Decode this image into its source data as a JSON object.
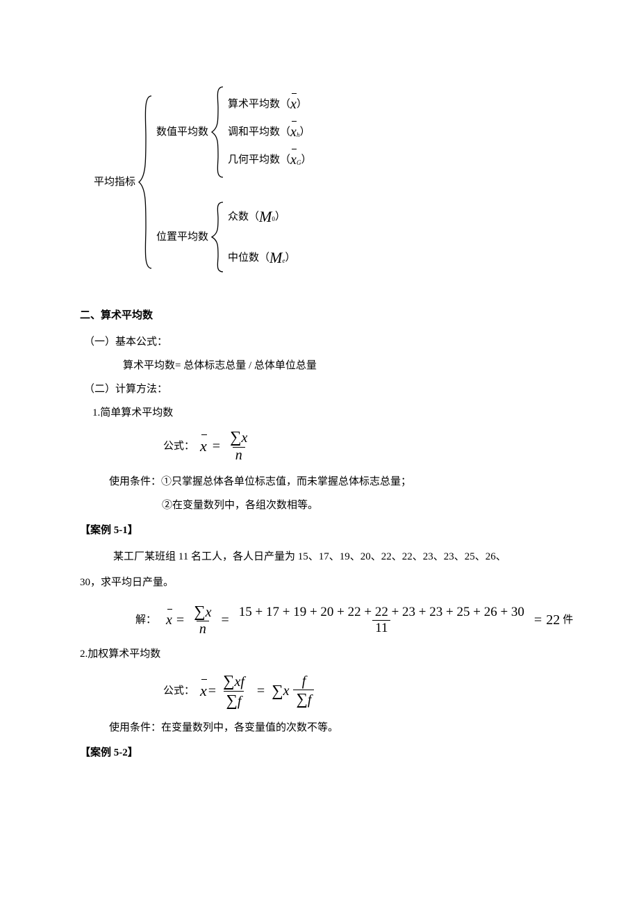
{
  "tree": {
    "root": "平均指标",
    "branch1": {
      "label": "数值平均数",
      "items": [
        {
          "text": "算术平均数（",
          "sym": "x",
          "bar": true,
          "sub": "",
          "close": "）"
        },
        {
          "text": "调和平均数（",
          "sym": "x",
          "bar": true,
          "sub": "h",
          "close": "）"
        },
        {
          "text": "几何平均数（",
          "sym": "x",
          "bar": true,
          "sub": "G",
          "close": "）"
        }
      ]
    },
    "branch2": {
      "label": "位置平均数",
      "items": [
        {
          "text": "众数（",
          "sym": "M",
          "bar": false,
          "sub": "0",
          "close": "）"
        },
        {
          "text": "中位数（",
          "sym": "M",
          "bar": false,
          "sub": "e",
          "close": "）"
        }
      ]
    }
  },
  "section2": {
    "heading": "二、算术平均数",
    "sub1_title": "（一）基本公式：",
    "sub1_body": "算术平均数=  总体标志总量  /  总体单位总量",
    "sub2_title": "（二）计算方法：",
    "m1_title": "1.简单算术平均数",
    "formula1_label": "公式：",
    "cond_label": "使用条件：①只掌握总体各单位标志值，而未掌握总体标志总量；",
    "cond_label2": "②在变量数列中，各组次数相等。"
  },
  "case1": {
    "title": "【案例 5-1】",
    "body1": "某工厂某班组 11 名工人，各人日产量为 15、17、19、20、22、22、23、23、25、26、",
    "body2": "30，求平均日产量。",
    "solution_label": "解：",
    "numerator": "15 + 17 + 19 + 20 + 22 + 22 + 23 + 23 + 25 + 26 + 30",
    "denominator": "11",
    "result": "22",
    "unit": "件"
  },
  "m2": {
    "title": "2.加权算术平均数",
    "formula_label": "公式：",
    "cond": "使用条件：在变量数列中，各变量值的次数不等。"
  },
  "case2": {
    "title": "【案例 5-2】"
  }
}
